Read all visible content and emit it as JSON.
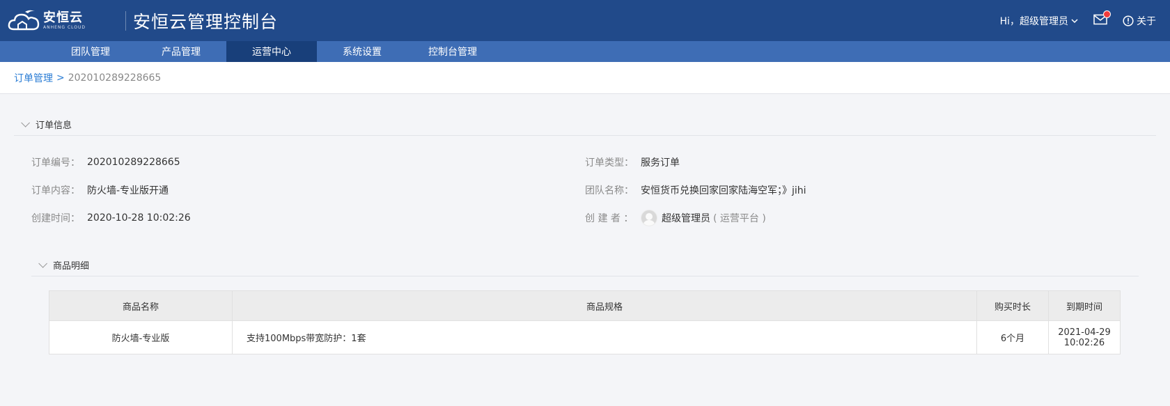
{
  "header": {
    "logo_main": "安恒云",
    "logo_sub": "ANHENG CLOUD",
    "title": "安恒云管理控制台",
    "user_greeting": "Hi，超级管理员",
    "about_label": "关于"
  },
  "nav": {
    "items": [
      {
        "label": "团队管理"
      },
      {
        "label": "产品管理"
      },
      {
        "label": "运营中心",
        "active": true
      },
      {
        "label": "系统设置"
      },
      {
        "label": "控制台管理"
      }
    ]
  },
  "breadcrumb": {
    "parent": "订单管理",
    "separator": ">",
    "current": "202010289228665"
  },
  "order_info": {
    "section_title": "订单信息",
    "order_no_label": "订单编号：",
    "order_no": "202010289228665",
    "order_type_label": "订单类型：",
    "order_type": "服务订单",
    "content_label": "订单内容：",
    "content": "防火墙-专业版开通",
    "team_label": "团队名称：",
    "team": "安恒货币兑换回家回家陆海空军；》jihi",
    "created_label": "创建时间：",
    "created": "2020-10-28 10:02:26",
    "creator_label": "创 建 者 ：",
    "creator": "超级管理员",
    "creator_role": "( 运营平台 )"
  },
  "goods": {
    "section_title": "商品明细",
    "columns": [
      "商品名称",
      "商品规格",
      "购买时长",
      "到期时间"
    ],
    "rows": [
      {
        "name": "防火墙-专业版",
        "spec": "支持100Mbps带宽防护：1套",
        "duration": "6个月",
        "expire_date": "2021-04-29",
        "expire_time": "10:02:26"
      }
    ]
  },
  "colors": {
    "header_bg": "#214a8a",
    "nav_bg": "#3e6db5",
    "nav_active": "#183f7a",
    "link": "#2a7cd4",
    "notify_dot": "#f03b3b"
  }
}
